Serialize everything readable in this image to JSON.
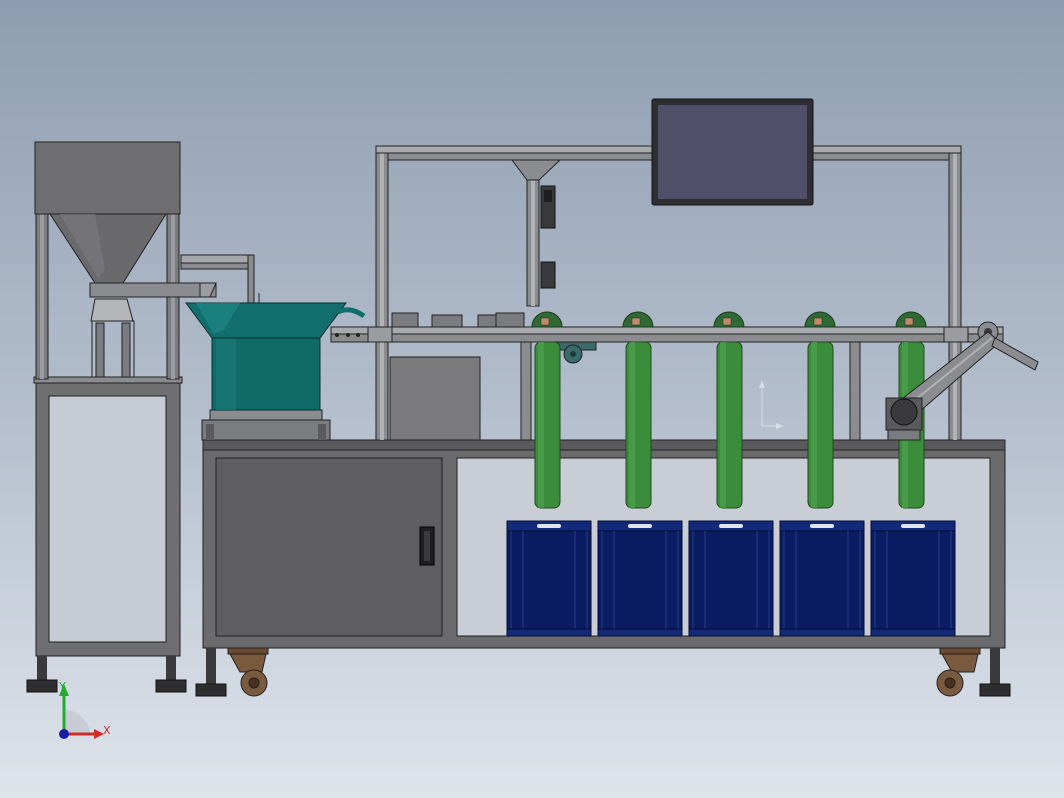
{
  "triad": {
    "x_label": "X",
    "y_label": "Y",
    "x_color": "#d42a2a",
    "y_color": "#22aa33",
    "origin_color": "#1a1aa8"
  },
  "colors": {
    "frame": "#6b6d71",
    "frame_light": "#8a8c90",
    "panel": "#6f6f72",
    "cabinet": "#616164",
    "bowl": "#0f6a68",
    "tube": "#3b8d3b",
    "bin": "#0a1c62",
    "monitor_bezel": "#2e2e33",
    "monitor_screen": "#4f4f6a",
    "caster": "#7a5a3e"
  },
  "machine": {
    "sorting_station_count": 5,
    "bin_count": 5,
    "has_vibratory_bowl": true,
    "has_hopper": true,
    "has_monitor": true,
    "has_incline_conveyor": true
  }
}
